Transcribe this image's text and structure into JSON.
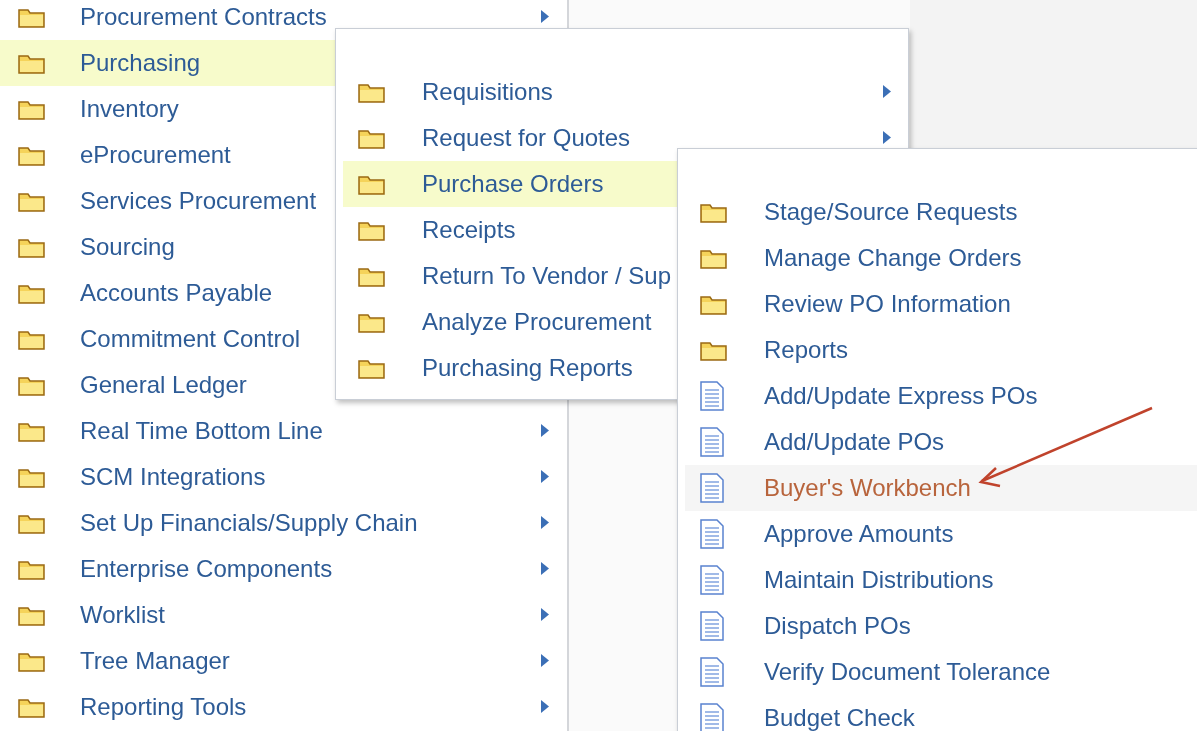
{
  "main_menu": {
    "items": [
      {
        "label": "Procurement Contracts",
        "kind": "folder",
        "selected": false,
        "arrow": true
      },
      {
        "label": "Purchasing",
        "kind": "folder",
        "selected": true,
        "arrow": false
      },
      {
        "label": "Inventory",
        "kind": "folder",
        "selected": false,
        "arrow": false
      },
      {
        "label": "eProcurement",
        "kind": "folder",
        "selected": false,
        "arrow": false
      },
      {
        "label": "Services Procurement",
        "kind": "folder",
        "selected": false,
        "arrow": false
      },
      {
        "label": "Sourcing",
        "kind": "folder",
        "selected": false,
        "arrow": false
      },
      {
        "label": "Accounts Payable",
        "kind": "folder",
        "selected": false,
        "arrow": false
      },
      {
        "label": "Commitment Control",
        "kind": "folder",
        "selected": false,
        "arrow": false
      },
      {
        "label": "General Ledger",
        "kind": "folder",
        "selected": false,
        "arrow": false
      },
      {
        "label": "Real Time Bottom Line",
        "kind": "folder",
        "selected": false,
        "arrow": true
      },
      {
        "label": "SCM Integrations",
        "kind": "folder",
        "selected": false,
        "arrow": true
      },
      {
        "label": "Set Up Financials/Supply Chain",
        "kind": "folder",
        "selected": false,
        "arrow": true
      },
      {
        "label": "Enterprise Components",
        "kind": "folder",
        "selected": false,
        "arrow": true
      },
      {
        "label": "Worklist",
        "kind": "folder",
        "selected": false,
        "arrow": true
      },
      {
        "label": "Tree Manager",
        "kind": "folder",
        "selected": false,
        "arrow": true
      },
      {
        "label": "Reporting Tools",
        "kind": "folder",
        "selected": false,
        "arrow": true
      }
    ]
  },
  "submenu": {
    "items": [
      {
        "label": "Requisitions",
        "kind": "folder",
        "selected": false,
        "arrow": true
      },
      {
        "label": "Request for Quotes",
        "kind": "folder",
        "selected": false,
        "arrow": true
      },
      {
        "label": "Purchase Orders",
        "kind": "folder",
        "selected": true,
        "arrow": false
      },
      {
        "label": "Receipts",
        "kind": "folder",
        "selected": false,
        "arrow": false
      },
      {
        "label": "Return To Vendor / Sup",
        "kind": "folder",
        "selected": false,
        "arrow": false
      },
      {
        "label": "Analyze Procurement",
        "kind": "folder",
        "selected": false,
        "arrow": false
      },
      {
        "label": "Purchasing Reports",
        "kind": "folder",
        "selected": false,
        "arrow": false
      }
    ]
  },
  "submenu_2": {
    "items": [
      {
        "label": "Stage/Source Requests",
        "kind": "folder",
        "hovered": false
      },
      {
        "label": "Manage Change Orders",
        "kind": "folder",
        "hovered": false
      },
      {
        "label": "Review PO Information",
        "kind": "folder",
        "hovered": false
      },
      {
        "label": "Reports",
        "kind": "folder",
        "hovered": false
      },
      {
        "label": "Add/Update Express POs",
        "kind": "page",
        "hovered": false
      },
      {
        "label": "Add/Update POs",
        "kind": "page",
        "hovered": false
      },
      {
        "label": "Buyer's Workbench",
        "kind": "page",
        "hovered": true
      },
      {
        "label": "Approve Amounts",
        "kind": "page",
        "hovered": false
      },
      {
        "label": "Maintain Distributions",
        "kind": "page",
        "hovered": false
      },
      {
        "label": "Dispatch POs",
        "kind": "page",
        "hovered": false
      },
      {
        "label": "Verify Document Tolerance",
        "kind": "page",
        "hovered": false
      },
      {
        "label": "Budget Check",
        "kind": "page",
        "hovered": false
      }
    ]
  }
}
